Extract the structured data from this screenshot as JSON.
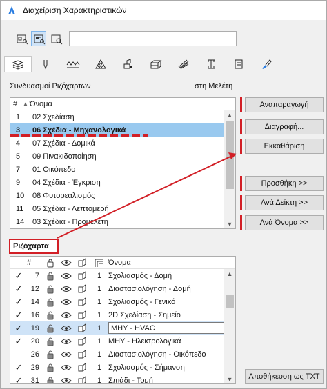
{
  "window": {
    "title": "Διαχείριση Χαρακτηριστικών"
  },
  "search": {
    "placeholder": ""
  },
  "view_buttons": [
    "list-view-icon",
    "detail-view-icon",
    "preview-view-icon"
  ],
  "tabs": [
    "layers-icon",
    "pen-icon",
    "line-type-icon",
    "fill-icon",
    "surface-icon",
    "composite-icon",
    "profile-icon",
    "zone-icon",
    "marker-icon",
    "paint-icon"
  ],
  "combos": {
    "label": "Συνδυασμοί Ριζόχαρτων",
    "in_project": "στη Μελέτη",
    "header_num": "#",
    "header_name": "Όνομα",
    "rows": [
      {
        "num": "1",
        "name": "02 Σχεδίαση"
      },
      {
        "num": "3",
        "name": "06 Σχέδια - Μηχανολογικά",
        "selected": true
      },
      {
        "num": "4",
        "name": "07 Σχέδια - Δομικά"
      },
      {
        "num": "5",
        "name": "09 Πινακιδοποίηση"
      },
      {
        "num": "7",
        "name": "01 Οικόπεδο"
      },
      {
        "num": "9",
        "name": "04 Σχέδια - Έγκριση"
      },
      {
        "num": "10",
        "name": "08 Φυτορεαλισμός"
      },
      {
        "num": "11",
        "name": "05 Σχέδια - Λεπτομερή"
      },
      {
        "num": "14",
        "name": "03 Σχέδια - Προμελέτη"
      }
    ]
  },
  "buttons": {
    "reproduce": "Αναπαραγωγή",
    "delete": "Διαγραφή...",
    "clear": "Εκκαθάριση",
    "add": "Προσθήκη >>",
    "by_index": "Ανά Δείκτη >>",
    "by_name": "Ανά Όνομα >>",
    "save_txt": "Αποθήκευση ως TXT"
  },
  "layers": {
    "label": "Ριζόχαρτα",
    "header_num": "#",
    "header_name": "Όνομα",
    "rows": [
      {
        "check": "✓",
        "num": "7",
        "pen": "1",
        "name": "Σχολιασμός - Δομή"
      },
      {
        "check": "✓",
        "num": "12",
        "pen": "1",
        "name": "Διαστασιολόγηση - Δομή"
      },
      {
        "check": "✓",
        "num": "14",
        "pen": "1",
        "name": "Σχολιασμός - Γενικό"
      },
      {
        "check": "✓",
        "num": "16",
        "pen": "1",
        "name": "2D Σχεδίαση - Σημείο"
      },
      {
        "check": "✓",
        "num": "19",
        "pen": "1",
        "name": "ΜΗΥ - HVAC",
        "selected": true
      },
      {
        "check": "✓",
        "num": "20",
        "pen": "1",
        "name": "ΜΗΥ - Ηλεκτρολογικά"
      },
      {
        "check": "",
        "num": "26",
        "pen": "1",
        "name": "Διαστασιολόγηση - Οικόπεδο"
      },
      {
        "check": "✓",
        "num": "29",
        "pen": "1",
        "name": "Σχολιασμός - Σήμανση"
      },
      {
        "check": "✓",
        "num": "31",
        "pen": "1",
        "name": "Σπιάδι - Τομή"
      }
    ]
  }
}
